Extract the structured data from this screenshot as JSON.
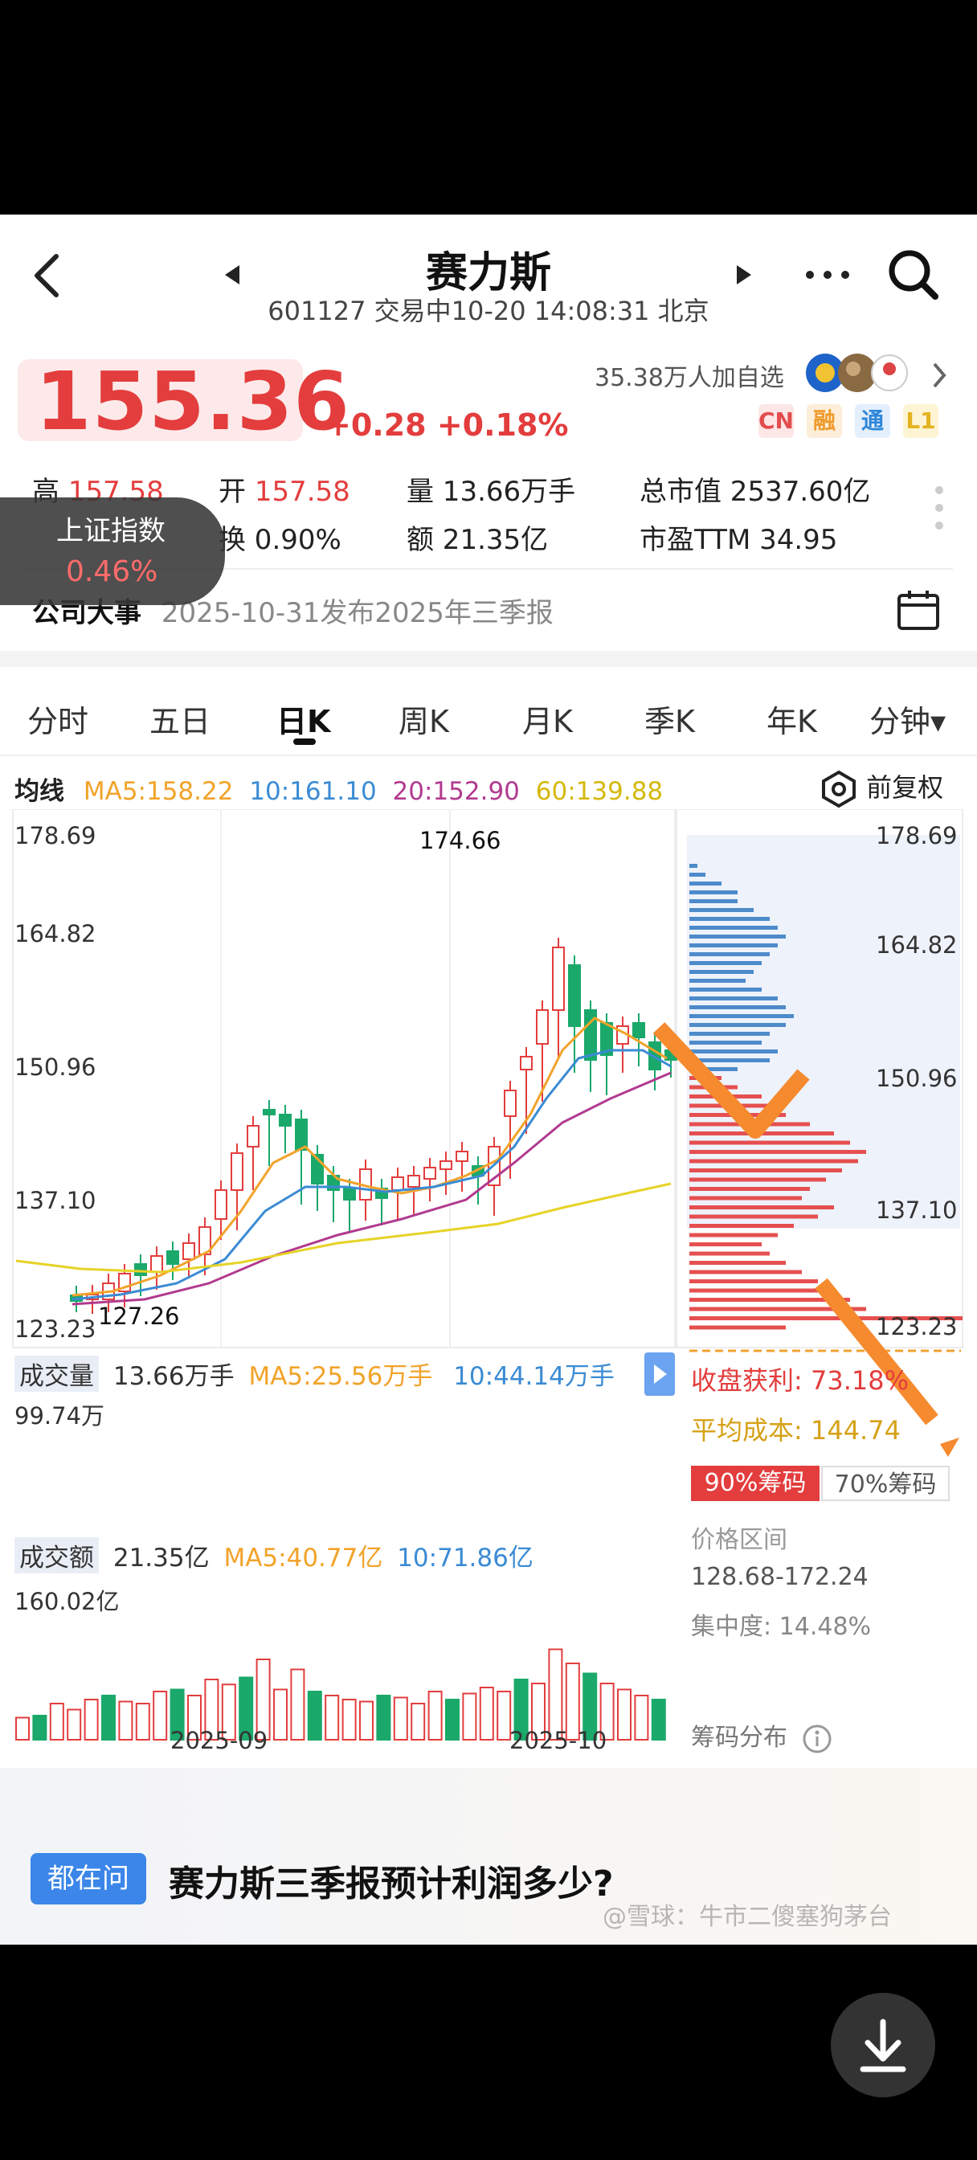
{
  "header": {
    "stock_name": "赛力斯",
    "subtitle": "601127 交易中10-20 14:08:31 北京"
  },
  "quote": {
    "price": "155.36",
    "change": "+0.28 +0.18%",
    "followers": "35.38万人加自选",
    "badges": [
      "CN",
      "融",
      "通",
      "L1"
    ],
    "stats": {
      "high_label": "高",
      "high_value": "157.58",
      "open_label": "开",
      "open_value": "157.58",
      "volume": "量 13.66万手",
      "market_cap": "总市值 2537.60亿",
      "turnover": "换 0.90%",
      "amount": "额 21.35亿",
      "pe": "市盈TTM 34.95"
    },
    "event_label": "公司大事",
    "event_text": "2025-10-31发布2025年三季报"
  },
  "index_tooltip": {
    "name": "上证指数",
    "change": "0.46%"
  },
  "tabs": [
    "分时",
    "五日",
    "日K",
    "周K",
    "月K",
    "季K",
    "年K",
    "分钟▾"
  ],
  "active_tab": "日K",
  "ma_legend": {
    "label": "均线",
    "ma5": "MA5:158.22",
    "ma10": "10:161.10",
    "ma20": "20:152.90",
    "ma60": "60:139.88",
    "adjust": "前复权"
  },
  "colors": {
    "up": "#e33d3d",
    "down": "#1aa86b",
    "ma5": "#f2a32a",
    "ma10": "#3b8bd4",
    "ma20": "#b23a8f",
    "ma60": "#e6d327",
    "arrow": "#f58a2e"
  },
  "price_axis": [
    "178.69",
    "164.82",
    "150.96",
    "137.10",
    "123.23"
  ],
  "kline_annotations": {
    "high": "174.66",
    "low": "127.26"
  },
  "volume_panel": {
    "label": "成交量",
    "value": "13.66万手",
    "ma5": "MA5:25.56万手",
    "ma10": "10:44.14万手",
    "max": "99.74万"
  },
  "amount_panel": {
    "label": "成交额",
    "value": "21.35亿",
    "ma5": "MA5:40.77亿",
    "ma10": "10:71.86亿",
    "max": "160.02亿"
  },
  "date_axis": [
    "2025-09",
    "2025-10"
  ],
  "chips": {
    "profit_label": "收盘获利:",
    "profit_value": "73.18%",
    "cost_label": "平均成本:",
    "cost_value": "144.74",
    "tab90": "90%筹码",
    "tab70": "70%筹码",
    "range_label": "价格区间",
    "range_value": "128.68-172.24",
    "concentration": "集中度: 14.48%",
    "dist_label": "筹码分布"
  },
  "ask": {
    "tag": "都在问",
    "question": "赛力斯三季报预计利润多少?"
  },
  "watermark": "@雪球：牛市二傻塞狗茅台"
}
